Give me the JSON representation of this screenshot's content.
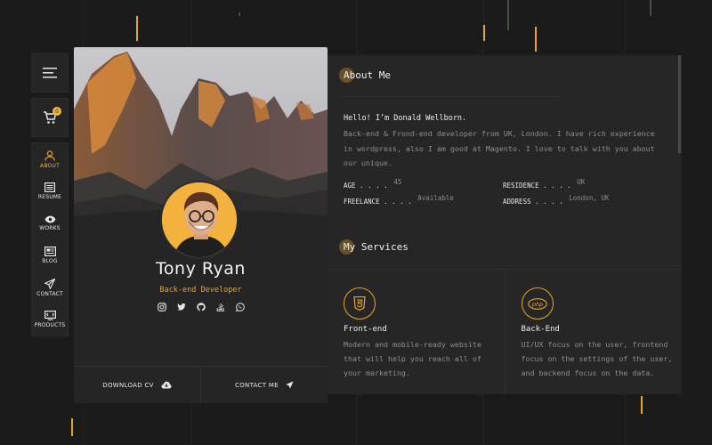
{
  "nav": {
    "items": [
      {
        "label": "ABOUT",
        "icon": "user-icon",
        "active": true
      },
      {
        "label": "RESUME",
        "icon": "resume-icon"
      },
      {
        "label": "WORKS",
        "icon": "eye-icon"
      },
      {
        "label": "BLOG",
        "icon": "newspaper-icon"
      },
      {
        "label": "CONTACT",
        "icon": "send-icon"
      },
      {
        "label": "PRODUCTS",
        "icon": "monitor-icon"
      }
    ],
    "cart_count": "0"
  },
  "profile": {
    "name": "Tony Ryan",
    "role": "Back-end Developer",
    "socials": [
      "instagram-icon",
      "twitter-icon",
      "github-icon",
      "stackoverflow-icon",
      "whatsapp-icon"
    ],
    "download_label": "DOWNLOAD CV",
    "contact_label": "CONTACT ME"
  },
  "about": {
    "title": "About Me",
    "greeting": "Hello! I’m Donald Wellborn.",
    "bio": "Back-end & Frond-end developer from UK, London. I have rich experience in wordpress, also I am good at Magento. I love to talk with you about our unique.",
    "facts": [
      {
        "label": "AGE . . . .",
        "value": "45"
      },
      {
        "label": "RESIDENCE . . . .",
        "value": "UK"
      },
      {
        "label": "FREELANCE . . . .",
        "value": "Available"
      },
      {
        "label": "ADDRESS . . . .",
        "value": "London, UK"
      }
    ]
  },
  "services": {
    "title": "My Services",
    "items": [
      {
        "title": "Front-end",
        "icon": "html5-icon",
        "desc": "Modern and mobile-ready website that will help you reach all of your marketing."
      },
      {
        "title": "Back-End",
        "icon": "php-icon",
        "desc": "UI/UX focus on the user, frontend focus on the settings of the user, and backend focus on the data."
      }
    ]
  },
  "colors": {
    "accent": "#e8a628",
    "panel": "#262626",
    "background": "#1b1b1b"
  }
}
